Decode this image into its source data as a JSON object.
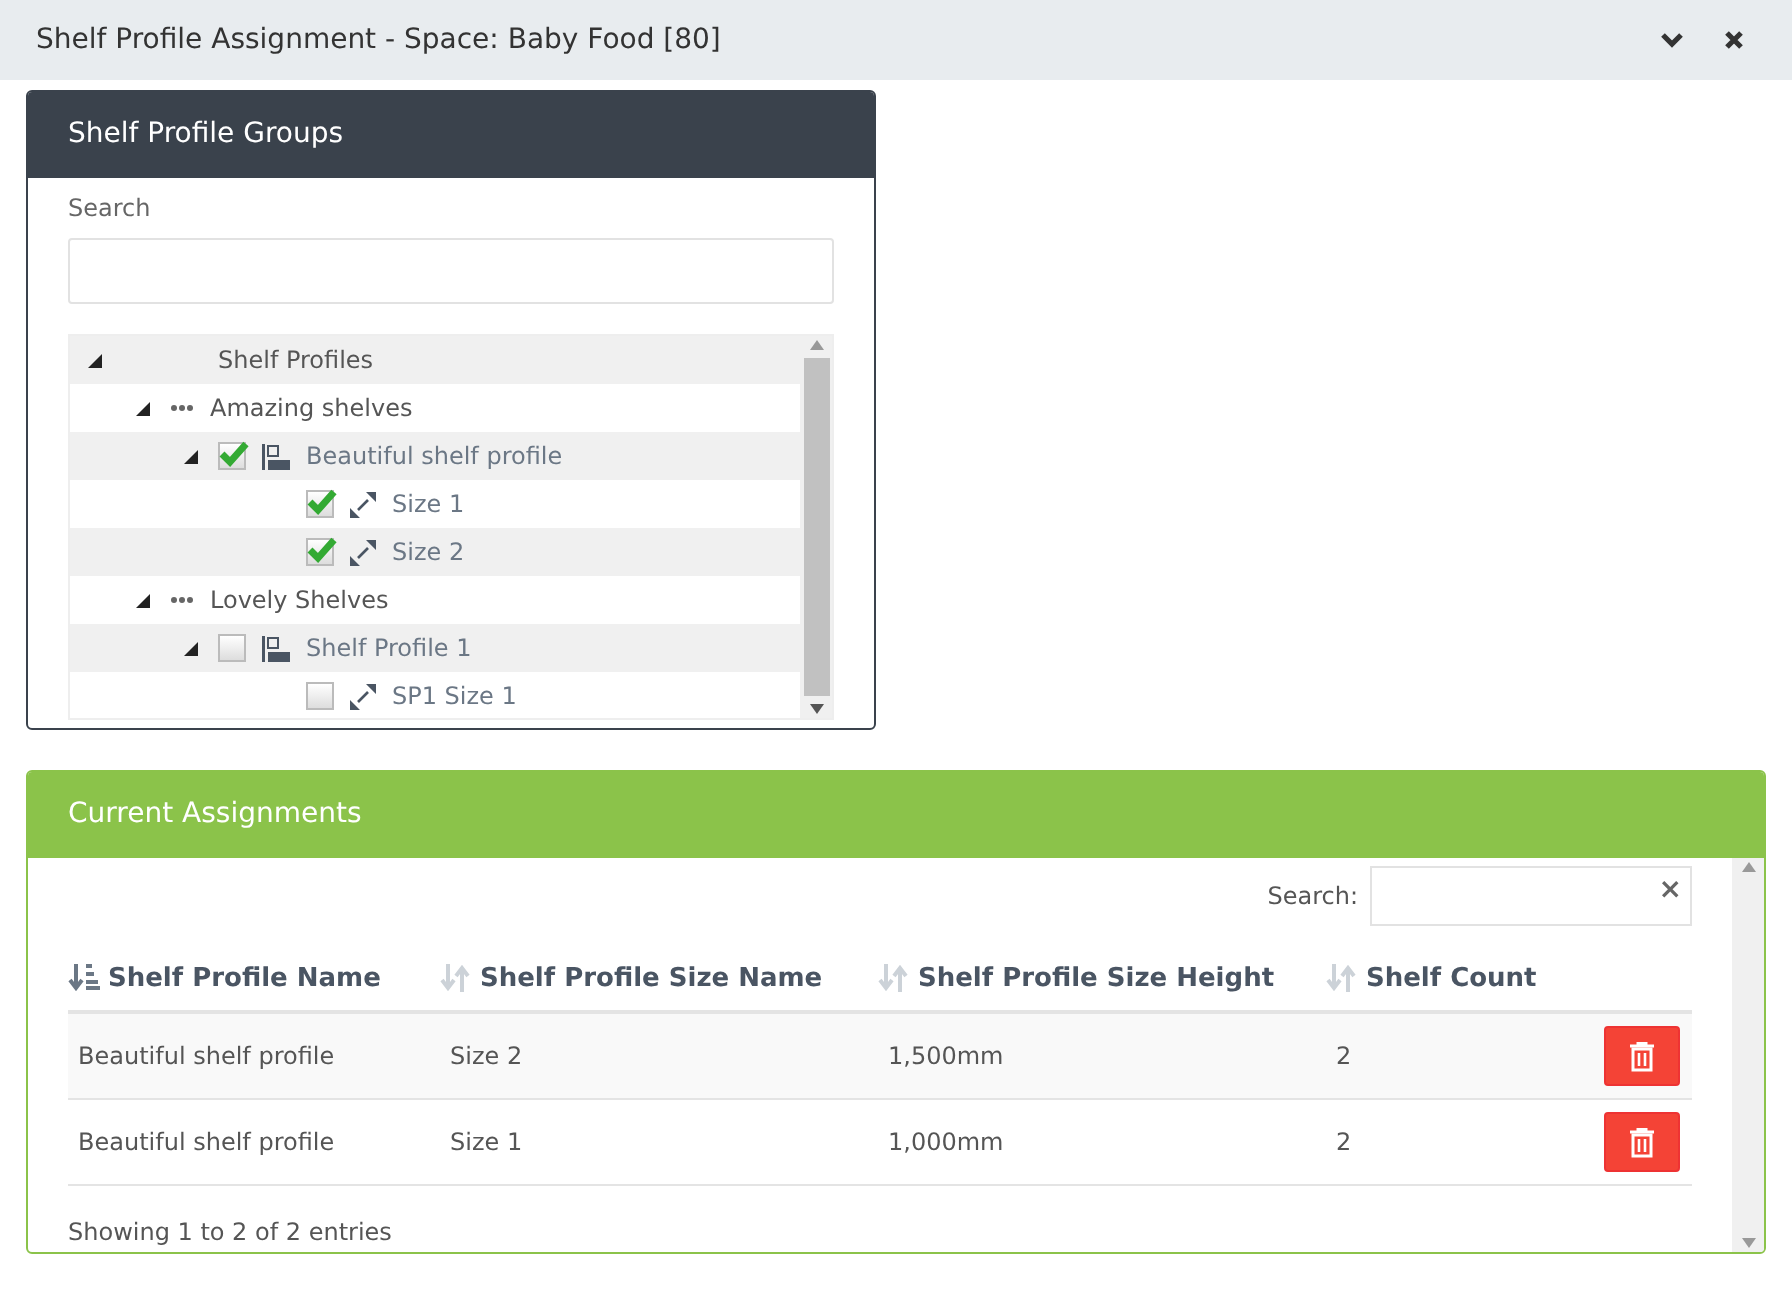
{
  "window": {
    "title": "Shelf Profile Assignment - Space: Baby Food [80]",
    "buttons": [
      {
        "kind": "collapse"
      },
      {
        "kind": "close"
      }
    ]
  },
  "groups_panel": {
    "title": "Shelf Profile Groups",
    "search_label": "Search",
    "tree": [
      {
        "label": "Shelf Profiles",
        "kind": "root",
        "expanded": true,
        "children": [
          {
            "label": "Amazing shelves",
            "kind": "group",
            "expanded": true,
            "children": [
              {
                "label": "Beautiful shelf profile",
                "kind": "profile",
                "expanded": true,
                "checked": true,
                "children": [
                  {
                    "label": "Size 1",
                    "kind": "size",
                    "checked": true
                  },
                  {
                    "label": "Size 2",
                    "kind": "size",
                    "checked": true
                  }
                ]
              }
            ]
          },
          {
            "label": "Lovely Shelves",
            "kind": "group",
            "expanded": true,
            "children": [
              {
                "label": "Shelf Profile 1",
                "kind": "profile",
                "expanded": true,
                "checked": false,
                "children": [
                  {
                    "label": "SP1 Size 1",
                    "kind": "size",
                    "checked": false
                  }
                ]
              }
            ]
          }
        ]
      }
    ]
  },
  "assignments_panel": {
    "title": "Current Assignments",
    "search_label": "Search:",
    "clear_symbol": "×",
    "columns": [
      {
        "label": "Shelf Profile Name",
        "sorted": true
      },
      {
        "label": "Shelf Profile Size Name",
        "sorted": false
      },
      {
        "label": "Shelf Profile Size Height",
        "sorted": false
      },
      {
        "label": "Shelf Count",
        "sorted": false
      }
    ],
    "rows": [
      [
        "Beautiful shelf profile",
        "Size 2",
        "1,500mm",
        "2"
      ],
      [
        "Beautiful shelf profile",
        "Size 1",
        "1,000mm",
        "2"
      ]
    ],
    "footer": "Showing 1 to 2 of 2 entries"
  }
}
